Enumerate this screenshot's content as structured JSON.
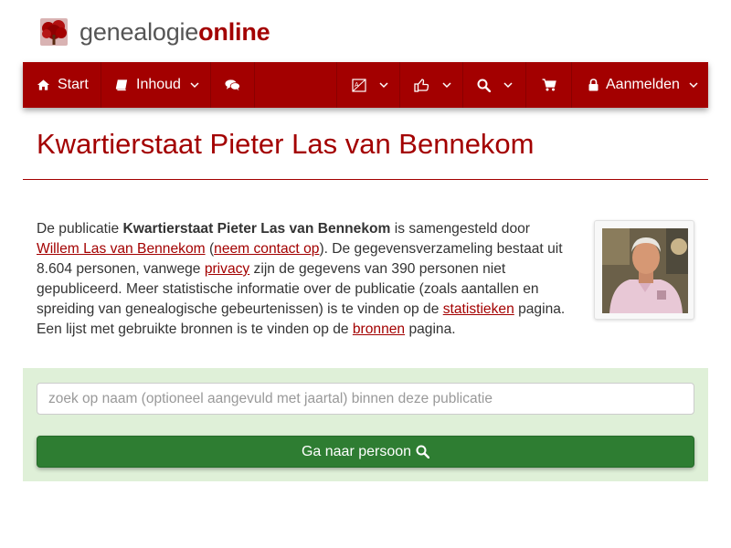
{
  "brand": {
    "name_plain": "genealogie",
    "name_accent": "online",
    "logo_icon": "tree-icon"
  },
  "colors": {
    "brand_red": "#a30000",
    "well_green": "#dff0d8",
    "button_green": "#2e7d32"
  },
  "nav": {
    "start_label": "Start",
    "inhoud_label": "Inhoud",
    "login_label": "Aanmelden",
    "icons": [
      "home-icon",
      "book-icon",
      "comments-icon",
      "language-icon",
      "thumbs-up-icon",
      "search-icon",
      "cart-icon",
      "lock-icon"
    ]
  },
  "page": {
    "title": "Kwartierstaat Pieter Las van Bennekom"
  },
  "description": {
    "t1": "De publicatie ",
    "pub_title": "Kwartierstaat Pieter Las van Bennekom",
    "t2": " is samengesteld door ",
    "author_link": "Willem Las van Bennekom",
    "t3": " (",
    "contact_link": "neem contact op",
    "t4": "). De gegevensverzameling bestaat uit 8.604 personen, vanwege ",
    "privacy_link": "privacy",
    "t5": " zijn de gegevens van 390 personen niet gepubliceerd. Meer statistische informatie over de publicatie (zoals aantallen en spreiding van genealogische gebeurtenissen) is te vinden op de ",
    "stats_link": "statistieken",
    "t6": " pagina. Een lijst met gebruikte bronnen is te vinden op de ",
    "sources_link": "bronnen",
    "t7": " pagina."
  },
  "search": {
    "placeholder": "zoek op naam (optioneel aangevuld met jaartal) binnen deze publicatie",
    "button_label": "Ga naar persoon"
  }
}
